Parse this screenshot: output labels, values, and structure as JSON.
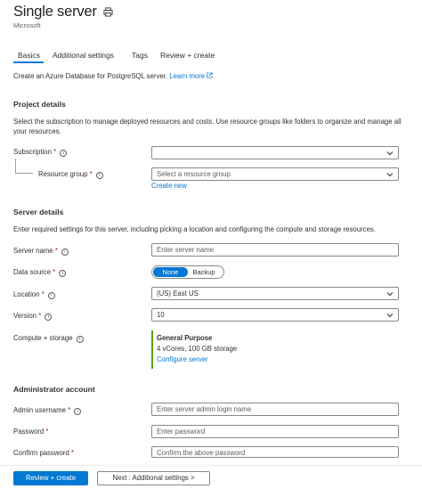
{
  "header": {
    "title": "Single server",
    "subtitle": "Microsoft",
    "print_icon": "printer-icon"
  },
  "tabs": [
    {
      "label": "Basics",
      "active": true
    },
    {
      "label": "Additional settings",
      "active": false
    },
    {
      "label": "Tags",
      "active": false
    },
    {
      "label": "Review + create",
      "active": false
    }
  ],
  "intro": {
    "text": "Create an Azure Database for PostgreSQL server.",
    "link": "Learn more"
  },
  "project": {
    "title": "Project details",
    "description": "Select the subscription to manage deployed resources and costs. Use resource groups like folders to organize and manage all your resources.",
    "subscription_label": "Subscription",
    "subscription_value": "",
    "resource_group_label": "Resource group",
    "resource_group_placeholder": "Select a resource group",
    "create_new": "Create new"
  },
  "server": {
    "title": "Server details",
    "description": "Enter required settings for this server, including picking a location and configuring the compute and storage resources.",
    "name_label": "Server name",
    "name_placeholder": "Enter server name",
    "data_source_label": "Data source",
    "data_source_options": [
      "None",
      "Backup"
    ],
    "data_source_selected": "None",
    "location_label": "Location",
    "location_value": "(US) East US",
    "version_label": "Version",
    "version_value": "10",
    "compute_label": "Compute + storage",
    "compute_tier": "General Purpose",
    "compute_desc": "4 vCores, 100 GB storage",
    "compute_link": "Configure server"
  },
  "admin": {
    "title": "Administrator account",
    "username_label": "Admin username",
    "username_placeholder": "Enter server admin login name",
    "password_label": "Password",
    "password_placeholder": "Enter password",
    "confirm_label": "Confirm password",
    "confirm_placeholder": "Confirm the above password"
  },
  "footer": {
    "review_create": "Review + create",
    "next": "Next : Additional settings >"
  },
  "required_mark": "*",
  "info_glyph": "i",
  "colors": {
    "accent": "#0078d4",
    "required": "#a4262c",
    "compute_bar": "#57a300"
  }
}
